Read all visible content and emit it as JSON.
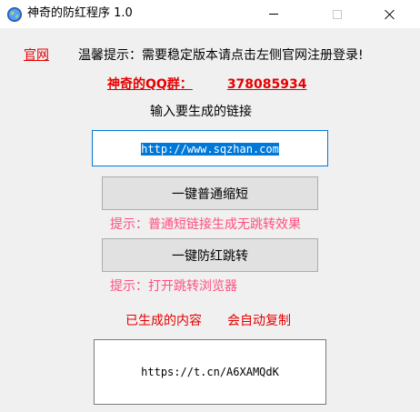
{
  "window": {
    "title": "神奇的防红程序 1.0"
  },
  "header": {
    "official_link": "官网",
    "tip": "温馨提示：需要稳定版本请点击左侧官网注册登录!"
  },
  "qq": {
    "label": "神奇的QQ群：",
    "number": "378085934"
  },
  "input": {
    "label": "输入要生成的链接",
    "value": "http://www.sqzhan.com"
  },
  "actions": {
    "shorten_label": "一键普通缩短",
    "shorten_hint": "提示：普通短链接生成无跳转效果",
    "anti_red_label": "一键防红跳转",
    "anti_red_hint": "提示：打开跳转浏览器"
  },
  "output": {
    "generated_label": "已生成的内容",
    "auto_copy_label": "会自动复制",
    "result": "https://t.cn/A6XAMQdK"
  },
  "icons": {
    "app": "globe-icon",
    "minimize": "minimize-icon",
    "maximize": "maximize-icon",
    "close": "close-icon"
  },
  "colors": {
    "accent_red": "#e60000",
    "hint_pink": "#ff4f80",
    "focus_blue": "#0078d7"
  }
}
